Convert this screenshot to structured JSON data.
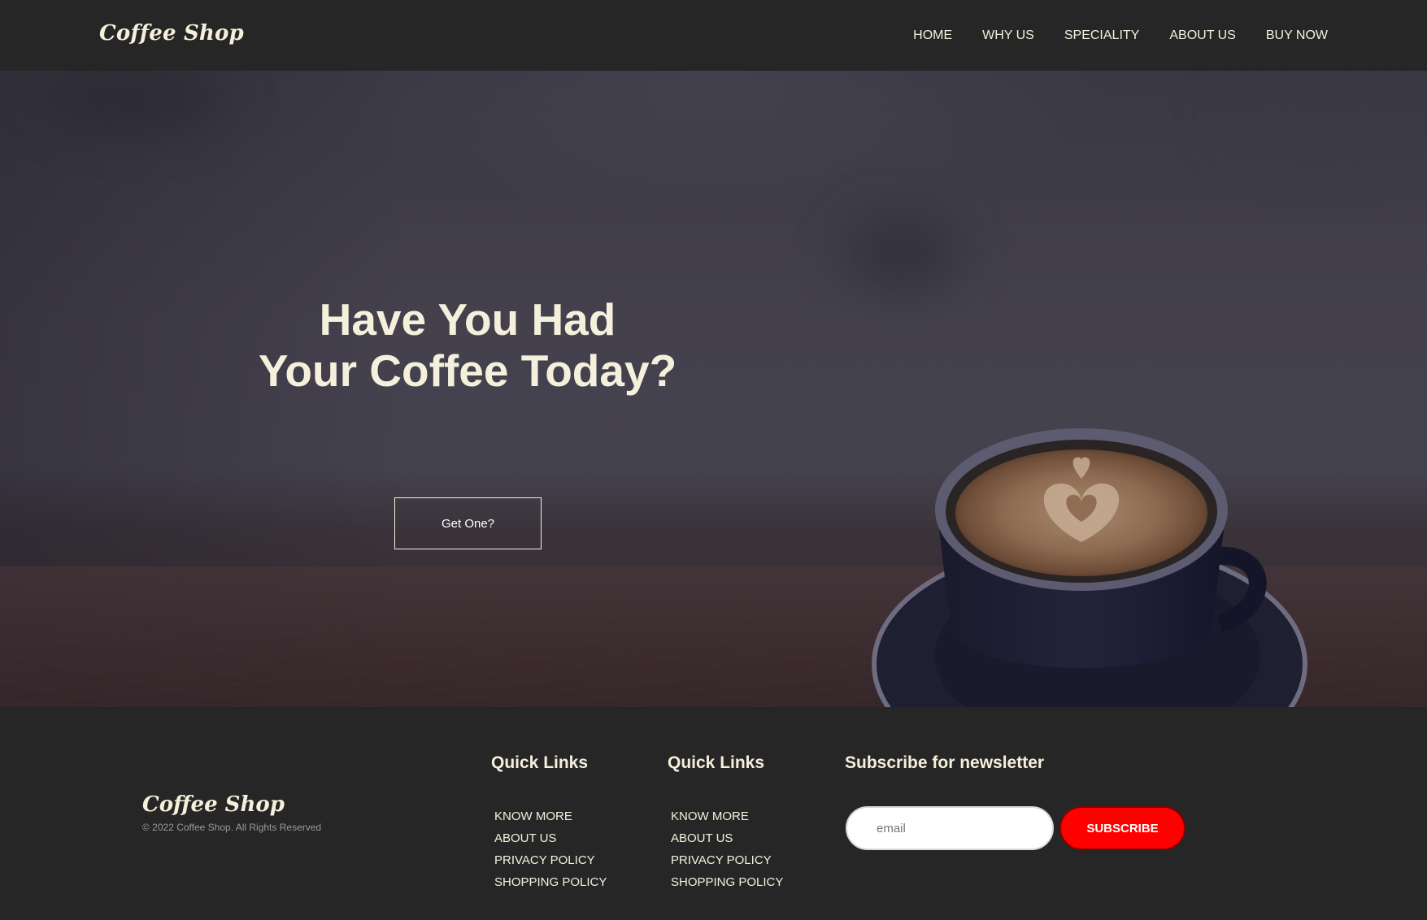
{
  "colors": {
    "nav_background": "#262626",
    "text_cream": "#f5f0dc",
    "subscribe_red": "#ff0000",
    "footer_background": "#262626"
  },
  "navbar": {
    "brand": "Coffee Shop",
    "links": [
      "HOME",
      "WHY US",
      "SPECIALITY",
      "ABOUT US",
      "BUY NOW"
    ]
  },
  "hero": {
    "title_line1": "Have You Had",
    "title_line2": "Your Coffee Today?",
    "cta_label": "Get One?",
    "image": "coffee-cup-latte-art"
  },
  "footer": {
    "brand": "Coffee Shop",
    "copyright": "© 2022 Coffee Shop. All Rights Reserved",
    "columns": [
      {
        "heading": "Quick Links",
        "links": [
          "KNOW MORE",
          "ABOUT US",
          "PRIVACY POLICY",
          "SHOPPING POLICY"
        ]
      },
      {
        "heading": "Quick Links",
        "links": [
          "KNOW MORE",
          "ABOUT US",
          "PRIVACY POLICY",
          "SHOPPING POLICY"
        ]
      }
    ],
    "newsletter": {
      "heading": "Subscribe for newsletter",
      "placeholder": "email",
      "button_label": "SUBSCRIBE"
    }
  }
}
